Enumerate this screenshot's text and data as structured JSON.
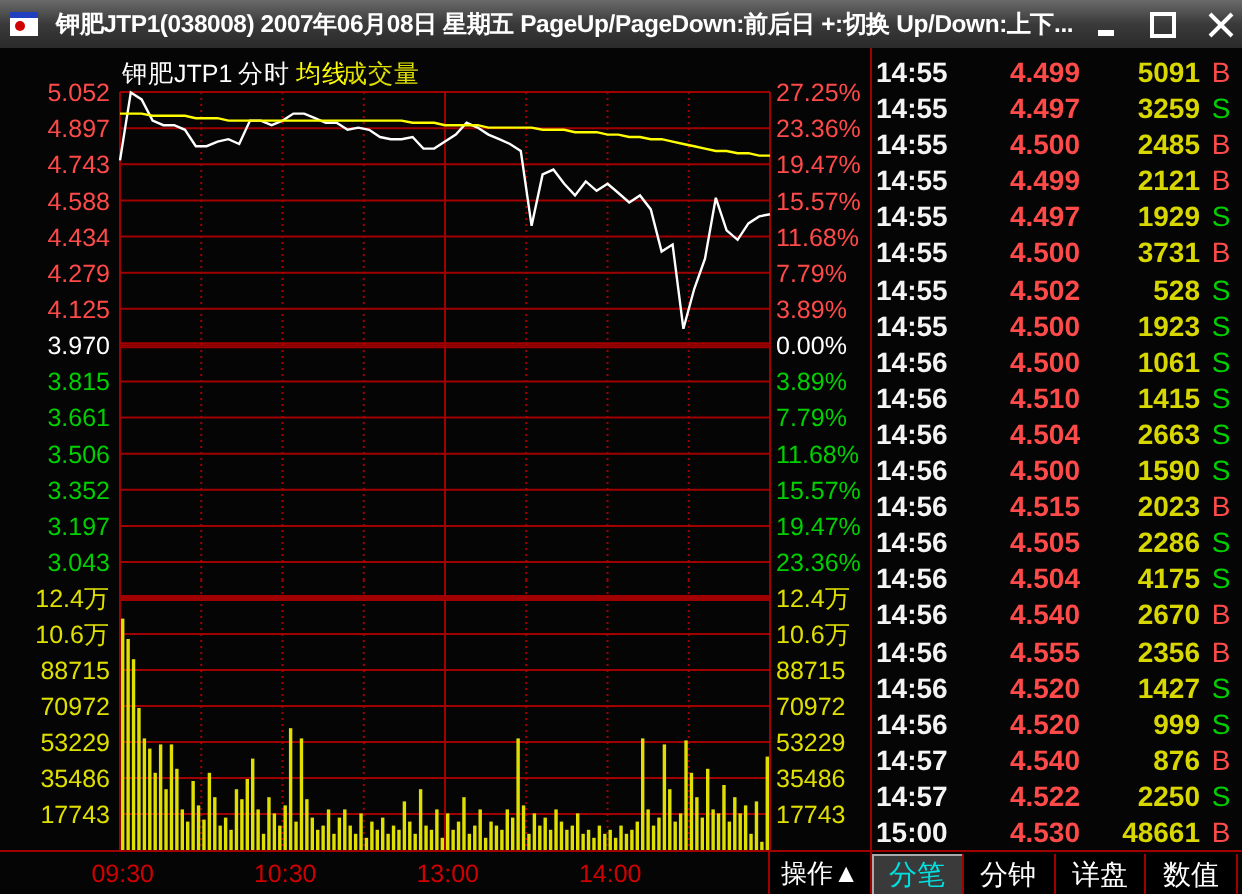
{
  "window": {
    "title": "钾肥JTP1(038008) 2007年06月08日 星期五 PageUp/PageDown:前后日 +:切换 Up/Down:上下..."
  },
  "chart_panel": {
    "price_chart": {
      "chart_data": {
        "type": "line",
        "title": "钾肥JTP1",
        "grid": true,
        "ylim": [
          3.043,
          5.052
        ],
        "yticks": [
          {
            "value": 5.052,
            "label": "5.052"
          },
          {
            "value": 4.897,
            "label": "4.897"
          },
          {
            "value": 4.743,
            "label": "4.743"
          },
          {
            "value": 4.588,
            "label": "4.588"
          },
          {
            "value": 4.434,
            "label": "4.434"
          },
          {
            "value": 4.279,
            "label": "4.279"
          },
          {
            "value": 4.125,
            "label": "4.125"
          },
          {
            "value": 3.97,
            "label": "3.970"
          },
          {
            "value": 3.815,
            "label": "3.815"
          },
          {
            "value": 3.661,
            "label": "3.661"
          },
          {
            "value": 3.506,
            "label": "3.506"
          },
          {
            "value": 3.352,
            "label": "3.352"
          },
          {
            "value": 3.197,
            "label": "3.197"
          },
          {
            "value": 3.043,
            "label": "3.043"
          }
        ],
        "categories": [
          null,
          null,
          null,
          null,
          null,
          null,
          null,
          null,
          null,
          null,
          null,
          null,
          null,
          null,
          null,
          null,
          null,
          null,
          null,
          null,
          null,
          null,
          null,
          null,
          null,
          null,
          null,
          null,
          null,
          null,
          null,
          null,
          null,
          null,
          null,
          null,
          null,
          null,
          null,
          null,
          null,
          null,
          null,
          null,
          null,
          null,
          null,
          null,
          null,
          null,
          null,
          null,
          null,
          null,
          null,
          null,
          null,
          null,
          null,
          null,
          null
        ],
        "series": [
          {
            "name": "分时",
            "color": "#ffffff",
            "values": [
              4.76,
              5.05,
              5.02,
              4.93,
              4.91,
              4.91,
              4.89,
              4.82,
              4.82,
              4.84,
              4.85,
              4.83,
              4.93,
              4.93,
              4.91,
              4.93,
              4.96,
              4.96,
              4.94,
              4.92,
              4.92,
              4.89,
              4.9,
              4.89,
              4.86,
              4.85,
              4.85,
              4.86,
              4.81,
              4.81,
              4.84,
              4.87,
              4.92,
              4.9,
              4.87,
              4.85,
              4.83,
              4.8,
              4.48,
              4.7,
              4.72,
              4.66,
              4.61,
              4.67,
              4.63,
              4.66,
              4.62,
              4.58,
              4.61,
              4.55,
              4.37,
              4.4,
              4.04,
              4.21,
              4.34,
              4.6,
              4.46,
              4.42,
              4.49,
              4.52,
              4.53
            ]
          },
          {
            "name": "均线",
            "color": "#ffff00",
            "values": [
              4.96,
              4.96,
              4.96,
              4.95,
              4.95,
              4.95,
              4.95,
              4.94,
              4.94,
              4.94,
              4.93,
              4.93,
              4.93,
              4.93,
              4.93,
              4.93,
              4.93,
              4.93,
              4.93,
              4.93,
              4.93,
              4.93,
              4.93,
              4.93,
              4.93,
              4.93,
              4.93,
              4.92,
              4.92,
              4.92,
              4.91,
              4.91,
              4.91,
              4.91,
              4.9,
              4.9,
              4.9,
              4.9,
              4.9,
              4.89,
              4.89,
              4.89,
              4.88,
              4.88,
              4.88,
              4.87,
              4.87,
              4.86,
              4.86,
              4.85,
              4.85,
              4.84,
              4.83,
              4.82,
              4.81,
              4.8,
              4.8,
              4.79,
              4.79,
              4.78,
              4.78
            ]
          }
        ]
      }
    },
    "percent_labels": [
      {
        "text": "27.25%",
        "color": "#ff4a4a"
      },
      {
        "text": "23.36%",
        "color": "#ff4a4a"
      },
      {
        "text": "19.47%",
        "color": "#ff4a4a"
      },
      {
        "text": "15.57%",
        "color": "#ff4a4a"
      },
      {
        "text": "11.68%",
        "color": "#ff4a4a"
      },
      {
        "text": "7.79%",
        "color": "#ff4a4a"
      },
      {
        "text": "3.89%",
        "color": "#ff4a4a"
      },
      {
        "text": "0.00%",
        "color": "#ffffff",
        "kind": "base"
      },
      {
        "text": "3.89%",
        "color": "#00d000"
      },
      {
        "text": "7.79%",
        "color": "#00d000"
      },
      {
        "text": "11.68%",
        "color": "#00d000"
      },
      {
        "text": "15.57%",
        "color": "#00d000"
      },
      {
        "text": "19.47%",
        "color": "#00d000"
      },
      {
        "text": "23.36%",
        "color": "#00d000"
      }
    ],
    "volume_upper_labels": [
      "12.4万",
      "10.6万"
    ],
    "volume_chart": {
      "chart_data": {
        "type": "bar",
        "grid": true,
        "ylim": [
          0,
          124201
        ],
        "yticks": [
          {
            "value": 88715,
            "label": "88715"
          },
          {
            "value": 70972,
            "label": "70972"
          },
          {
            "value": 53229,
            "label": "53229"
          },
          {
            "value": 35486,
            "label": "35486"
          },
          {
            "value": 17743,
            "label": "17743"
          }
        ],
        "categories": [
          "09:30",
          null,
          null,
          null,
          null,
          null,
          null,
          null,
          null,
          null,
          null,
          null,
          null,
          null,
          null,
          null,
          null,
          null,
          null,
          null,
          null,
          null,
          null,
          null,
          null,
          null,
          null,
          null,
          null,
          null,
          "10:30",
          null,
          null,
          null,
          null,
          null,
          null,
          null,
          null,
          null,
          null,
          null,
          null,
          null,
          null,
          null,
          null,
          null,
          null,
          null,
          null,
          null,
          null,
          null,
          null,
          null,
          null,
          null,
          null,
          null,
          "13:00",
          null,
          null,
          null,
          null,
          null,
          null,
          null,
          null,
          null,
          null,
          null,
          null,
          null,
          null,
          null,
          null,
          null,
          null,
          null,
          null,
          null,
          null,
          null,
          null,
          null,
          null,
          null,
          null,
          null,
          "14:00",
          null,
          null,
          null,
          null,
          null,
          null,
          null,
          null,
          null,
          null,
          null,
          null,
          null,
          null,
          null,
          null,
          null,
          null,
          null,
          null,
          null,
          null,
          null,
          null,
          null,
          null,
          null,
          null,
          null
        ],
        "series": [
          {
            "name": "成交量",
            "color": "#e0e000",
            "values": [
              114000,
              104000,
              94000,
              70000,
              55000,
              50000,
              38000,
              52000,
              30000,
              52000,
              40000,
              20000,
              14000,
              34000,
              22000,
              15000,
              38000,
              26000,
              12000,
              16000,
              10000,
              30000,
              25000,
              35000,
              45000,
              20000,
              8000,
              26000,
              18000,
              12000,
              22000,
              60000,
              14000,
              55000,
              25000,
              16000,
              10000,
              12000,
              20000,
              8000,
              16000,
              20000,
              12000,
              8000,
              18000,
              6000,
              14000,
              10000,
              16000,
              8000,
              12000,
              10000,
              24000,
              14000,
              8000,
              30000,
              12000,
              10000,
              20000,
              6000,
              18000,
              10000,
              14000,
              26000,
              8000,
              12000,
              20000,
              6000,
              14000,
              12000,
              10000,
              20000,
              16000,
              55000,
              22000,
              8000,
              18000,
              12000,
              16000,
              10000,
              20000,
              14000,
              10000,
              12000,
              18000,
              8000,
              10000,
              6000,
              12000,
              8000,
              10000,
              6000,
              12000,
              8000,
              10000,
              14000,
              55000,
              20000,
              12000,
              16000,
              52000,
              30000,
              14000,
              18000,
              54000,
              38000,
              26000,
              16000,
              40000,
              20000,
              18000,
              32000,
              14000,
              26000,
              18000,
              22000,
              8000,
              24000,
              4000,
              46000
            ]
          }
        ]
      }
    },
    "volume_right_labels": [
      "12.4万",
      "10.6万",
      "88715",
      "70972",
      "53229",
      "35486",
      "17743"
    ],
    "menu_button": "操作▲"
  },
  "trades": {
    "rows": [
      {
        "time": "14:55",
        "price": "4.499",
        "volume": "5091",
        "side": "B",
        "kind": "buy"
      },
      {
        "time": "14:55",
        "price": "4.497",
        "volume": "3259",
        "side": "S",
        "kind": "sell"
      },
      {
        "time": "14:55",
        "price": "4.500",
        "volume": "2485",
        "side": "B",
        "kind": "buy"
      },
      {
        "time": "14:55",
        "price": "4.499",
        "volume": "2121",
        "side": "B",
        "kind": "buy"
      },
      {
        "time": "14:55",
        "price": "4.497",
        "volume": "1929",
        "side": "S",
        "kind": "sell"
      },
      {
        "time": "14:55",
        "price": "4.500",
        "volume": "3731",
        "side": "B",
        "kind": "buy"
      },
      {
        "time": "14:55",
        "price": "4.502",
        "volume": "528",
        "side": "S",
        "kind": "sell"
      },
      {
        "time": "14:55",
        "price": "4.500",
        "volume": "1923",
        "side": "S",
        "kind": "sell"
      },
      {
        "time": "14:56",
        "price": "4.500",
        "volume": "1061",
        "side": "S",
        "kind": "sell"
      },
      {
        "time": "14:56",
        "price": "4.510",
        "volume": "1415",
        "side": "S",
        "kind": "sell"
      },
      {
        "time": "14:56",
        "price": "4.504",
        "volume": "2663",
        "side": "S",
        "kind": "sell"
      },
      {
        "time": "14:56",
        "price": "4.500",
        "volume": "1590",
        "side": "S",
        "kind": "sell"
      },
      {
        "time": "14:56",
        "price": "4.515",
        "volume": "2023",
        "side": "B",
        "kind": "buy"
      },
      {
        "time": "14:56",
        "price": "4.505",
        "volume": "2286",
        "side": "S",
        "kind": "sell"
      },
      {
        "time": "14:56",
        "price": "4.504",
        "volume": "4175",
        "side": "S",
        "kind": "sell"
      },
      {
        "time": "14:56",
        "price": "4.540",
        "volume": "2670",
        "side": "B",
        "kind": "buy"
      },
      {
        "time": "14:56",
        "price": "4.555",
        "volume": "2356",
        "side": "B",
        "kind": "buy"
      },
      {
        "time": "14:56",
        "price": "4.520",
        "volume": "1427",
        "side": "S",
        "kind": "sell"
      },
      {
        "time": "14:56",
        "price": "4.520",
        "volume": "999",
        "side": "S",
        "kind": "sell"
      },
      {
        "time": "14:57",
        "price": "4.540",
        "volume": "876",
        "side": "B",
        "kind": "buy"
      },
      {
        "time": "14:57",
        "price": "4.522",
        "volume": "2250",
        "side": "S",
        "kind": "sell"
      },
      {
        "time": "15:00",
        "price": "4.530",
        "volume": "48661",
        "side": "B",
        "kind": "buy"
      }
    ],
    "tabs": [
      {
        "label": "分笔",
        "selected": true
      },
      {
        "label": "分钟",
        "selected": false
      },
      {
        "label": "详盘",
        "selected": false
      },
      {
        "label": "数值",
        "selected": false
      }
    ]
  }
}
